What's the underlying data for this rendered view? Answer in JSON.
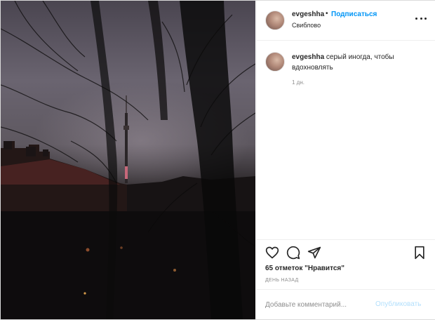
{
  "post": {
    "username": "evgeshha",
    "follow_label": "Подписаться",
    "separator": "•",
    "location": "Свиблово",
    "caption_text": "серый иногда, чтобы вдохновлять",
    "caption_time": "1 дн.",
    "likes_text": "65 отметок \"Нравится\"",
    "date_text": "ДЕНЬ НАЗАД",
    "comment_placeholder": "Добавьте комментарий...",
    "publish_label": "Опубликовать"
  },
  "icons": [
    "more-options-icon",
    "heart-icon",
    "comment-icon",
    "share-icon",
    "bookmark-icon"
  ],
  "colors": {
    "accent": "#0095f6",
    "text": "#262626",
    "muted": "#8e8e8e",
    "publish_disabled": "#b2dffc"
  }
}
